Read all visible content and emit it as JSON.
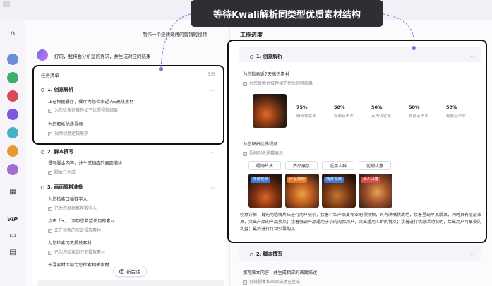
{
  "callout": {
    "title": "等待Kwali解析同类型优质素材结构"
  },
  "chat": {
    "user_prompt": "制作一个烧烤烧烤的营销短视频",
    "bot_message": "好的，我将会分析您的诉求，并生成对应的结果"
  },
  "task_list": {
    "title": "任务清单",
    "count": "5/5",
    "sections": [
      {
        "title": "1. 创意解析",
        "lines": [
          {
            "text": "正在根据餐厅，餐厅为您检索近7天高热素材",
            "sub": "为您检索并推荐如下优质视频结果"
          },
          {
            "text": "为您解析优质视频",
            "sub": "视频创意逻辑展示"
          }
        ]
      },
      {
        "title": "2. 脚本撰写",
        "lines": [
          {
            "text": "撰写脚本内容，并生成相应的画面描述",
            "sub": "脚本已生成"
          }
        ]
      },
      {
        "title": "3. 画面原料准备",
        "lines": [
          {
            "text": "为您检索口播数字人",
            "sub": "已为您根据推荐数字人"
          },
          {
            "text": "点击「+」，添加您希望使用的素材",
            "sub": "正在检索的历史投放素材"
          },
          {
            "text": "为您检索历史投放素材",
            "sub": "已为您检索到历史投放素材"
          },
          {
            "text": "千寻素材库中为您检索相关素材",
            "sub": ""
          }
        ]
      }
    ]
  },
  "new_chat": {
    "label": "新会话"
  },
  "work_progress": {
    "title": "工作进度",
    "section1": {
      "title": "1. 创意解析",
      "line1": "为您检索近7天高热素材",
      "sub1": "为您检索并推荐如下优质视频结果",
      "stats": [
        {
          "value": "75%",
          "label": "曝光转化率"
        },
        {
          "value": "50%",
          "label": "视频点击率"
        },
        {
          "value": "50%",
          "label": "点击转化率"
        },
        {
          "value": "50%",
          "label": "视频点击率"
        },
        {
          "value": "50%",
          "label": "视频点击率"
        }
      ],
      "line2": "为您解析优质视频...",
      "sub2": "视频创意逻辑展示",
      "tags": [
        "唱嗨片头",
        "产品展示",
        "适用人群",
        "促销优惠"
      ],
      "photo_labels": [
        "场景视频",
        "产品视频",
        "场景视频",
        "真人口播"
      ],
      "paragraph": "创意详解：首先用唱嗨片头进行用户吸引，接着介绍产品麦专业刷视频频，具有满嘴状质地，接着呈现早果肌果，同时具有层层效果，突出产品的产品卖点；接着强调产品适用于小肉肉脸用户，突出适用人群的特点；接着进行优惠活动说明，给出用户可享受的利益；最后进行行动引导购买。"
    },
    "section2": {
      "title": "2. 脚本撰写",
      "line1": "撰写脚本内容，并生成相应的画面描述",
      "sub1": "分镜脚本和画面描述已生成"
    }
  },
  "sidebar": {
    "vip_label": "VIP",
    "avatar_colors": [
      "#6a8fd8",
      "#3fae6a",
      "#d84a5a",
      "#7a5adf",
      "#46b3c4",
      "#e69b2f",
      "#9c6fd1"
    ]
  }
}
